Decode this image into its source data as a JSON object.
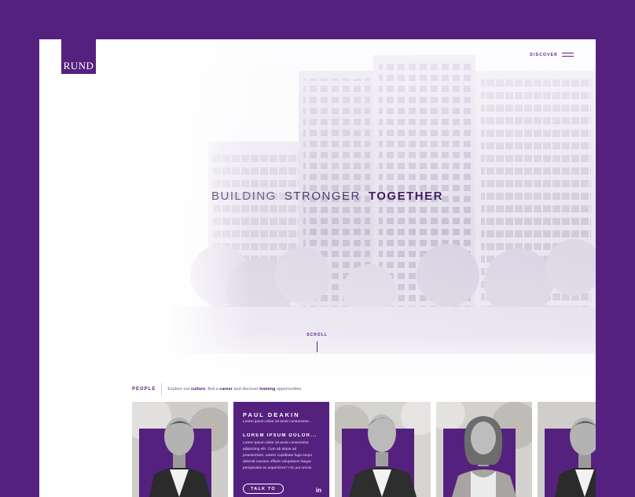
{
  "brand": {
    "logo_text": "RUND",
    "accent": "#55217f"
  },
  "nav": {
    "discover_label": "DISCOVER",
    "menu_icon": "hamburger-icon"
  },
  "hero": {
    "headline_word_1": "BUILDING",
    "headline_word_2": "STRONGER",
    "headline_word_3": "TOGETHER",
    "scroll_label": "SCROLL"
  },
  "people": {
    "label": "PEOPLE",
    "intro_1": "Explore our ",
    "intro_culture": "culture",
    "intro_2": ", find a ",
    "intro_career": "career",
    "intro_3": " and discover ",
    "intro_training": "training",
    "intro_4": " opportunities"
  },
  "featured": {
    "name": "PAUL DEAKIN",
    "line_1": "Lorem ipsum dolor sit amet consectetur...",
    "subtitle": "LOREM IPSUM DOLOR...",
    "p_line_1": "Lorem ipsum dolor sit amet consectetur",
    "p_line_2": "adipiscing elit. Cum ab atque ad",
    "p_line_3": "praesentium, autem cupiditate fuga sequi",
    "p_line_4": "deleniti maxime officiis voluptatum itaque",
    "p_line_5": "perspiciatis ex asperiores? Hic aut omnis.",
    "cta": "TALK TO",
    "social_icon": "linkedin-icon",
    "social_glyph": "in"
  }
}
